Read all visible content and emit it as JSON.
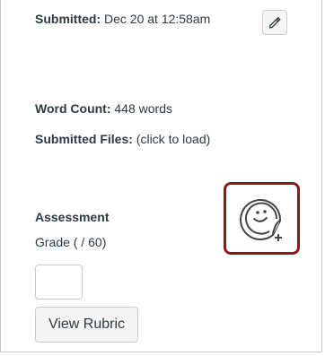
{
  "submission": {
    "submitted_label": "Submitted:",
    "submitted_value": "Dec 20 at 12:58am",
    "word_count_label": "Word Count:",
    "word_count_value": "448 words",
    "files_label": "Submitted Files:",
    "files_value": "(click to load)"
  },
  "assessment": {
    "title": "Assessment",
    "grade_label": "Grade ( / 60)",
    "grade_value": "",
    "view_rubric_label": "View Rubric"
  },
  "icons": {
    "edit": "pencil-icon",
    "sticker": "sticker-smiley-add-icon"
  },
  "colors": {
    "text": "#2d3b45",
    "border": "#c7cdd1",
    "button_bg": "#f5f5f5",
    "highlight": "#8b1a1a"
  }
}
